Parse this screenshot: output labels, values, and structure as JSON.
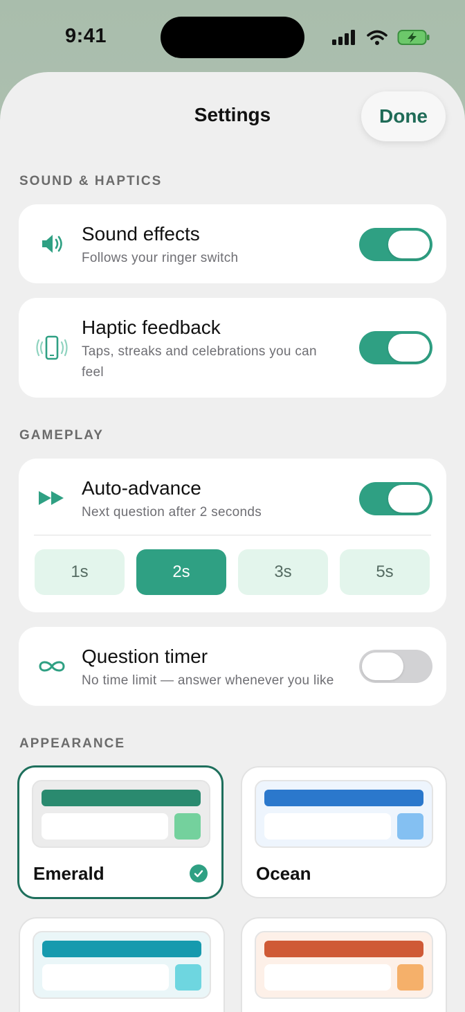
{
  "status_bar": {
    "time": "9:41"
  },
  "sheet": {
    "title": "Settings",
    "done_label": "Done"
  },
  "sections": {
    "sound": "SOUND & HAPTICS",
    "gameplay": "GAMEPLAY",
    "appearance": "APPEARANCE"
  },
  "sound_effects": {
    "title": "Sound effects",
    "subtitle": "Follows your ringer switch",
    "enabled": true,
    "icon": "speaker-icon"
  },
  "haptic": {
    "title": "Haptic feedback",
    "subtitle": "Taps, streaks and celebrations you can feel",
    "enabled": true,
    "icon": "phone-vibrate-icon"
  },
  "auto_advance": {
    "title": "Auto-advance",
    "subtitle": "Next question after 2 seconds",
    "enabled": true,
    "icon": "fast-forward-icon",
    "options": [
      "1s",
      "2s",
      "3s",
      "5s"
    ],
    "selected": "2s"
  },
  "timer": {
    "title": "Question timer",
    "subtitle": "No time limit — answer whenever you like",
    "enabled": false,
    "icon": "infinity-icon"
  },
  "themes": [
    {
      "name": "Emerald",
      "selected": true,
      "bar": "#2a8a6f",
      "square": "#74d19d",
      "bg": "#ececec"
    },
    {
      "name": "Ocean",
      "selected": false,
      "bar": "#2b78cc",
      "square": "#84c0f2",
      "bg": "#eef5fd"
    },
    {
      "name": "",
      "selected": false,
      "bar": "#169aae",
      "square": "#6ed6e0",
      "bg": "#eaf6f8"
    },
    {
      "name": "",
      "selected": false,
      "bar": "#cf5a36",
      "square": "#f5b06a",
      "bg": "#fdf0e8"
    }
  ],
  "colors": {
    "accent": "#2fa083",
    "done_text": "#1f6b57"
  }
}
